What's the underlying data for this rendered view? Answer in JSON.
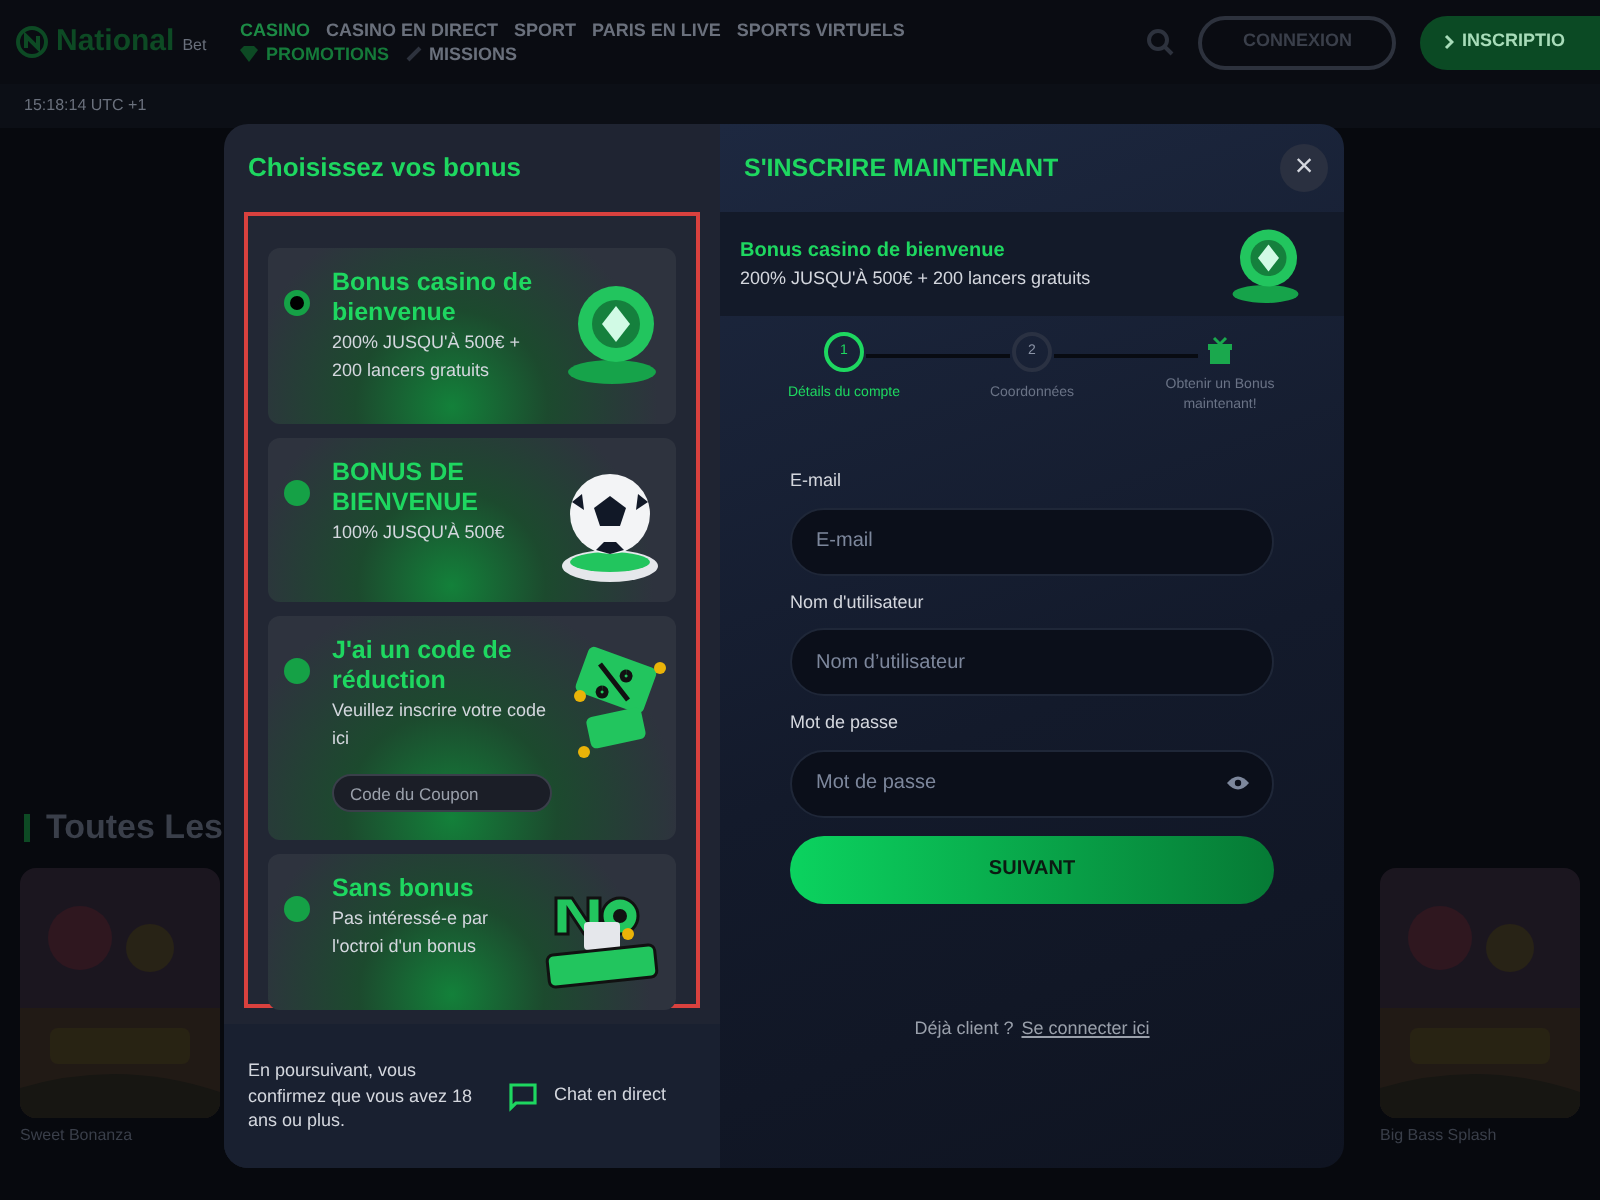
{
  "header": {
    "logo": {
      "name": "National",
      "suffix": "Bet"
    },
    "nav": [
      {
        "label": "CASINO",
        "selected": true,
        "kind": "text"
      },
      {
        "label": "CASINO EN DIRECT",
        "selected": false,
        "kind": "text"
      },
      {
        "label": "SPORT",
        "selected": false,
        "kind": "text"
      },
      {
        "label": "PARIS EN LIVE",
        "selected": false,
        "kind": "text"
      },
      {
        "label": "SPORTS VIRTUELS",
        "selected": false,
        "kind": "text"
      },
      {
        "label": "PROMOTIONS",
        "selected": false,
        "kind": "promo"
      },
      {
        "label": "MISSIONS",
        "selected": false,
        "kind": "missions"
      }
    ],
    "login": "CONNEXION",
    "signup": "INSCRIPTIO",
    "time": "15:18:14 UTC +1"
  },
  "section_title": "Toutes Les",
  "games": [
    {
      "name": "Sweet Bonanza"
    },
    {
      "name": "Big Bass Splash"
    }
  ],
  "modal": {
    "left": {
      "title": "Choisissez vos bonus",
      "options": [
        {
          "title": "Bonus casino de bienvenue",
          "description": "200% JUSQU'À 500€ + 200 lancers gratuits",
          "selected": true,
          "kind": "chip"
        },
        {
          "title": "BONUS DE BIENVENUE",
          "description": "100% JUSQU'À 500€",
          "selected": false,
          "kind": "ball"
        },
        {
          "title": "J'ai un code de réduction",
          "description": "Veuillez inscrire votre code ici",
          "selected": false,
          "kind": "coupon",
          "field": {
            "placeholder": "Code du Coupon"
          }
        },
        {
          "title": "Sans bonus",
          "description": "Pas intéressé-e par l'octroi d'un bonus",
          "selected": false,
          "kind": "nobonus"
        }
      ],
      "footer": "En poursuivant, vous confirmez que vous avez 18 ans ou plus.",
      "chat": "Chat en direct"
    },
    "right": {
      "title": "S'INSCRIRE MAINTENANT",
      "close": "×",
      "bonus": {
        "title": "Bonus casino de bienvenue",
        "description": "200% JUSQU'À 500€ + 200 lancers gratuits"
      },
      "steps": [
        {
          "kind": "number",
          "number": "1",
          "label": "Détails du compte",
          "selected": true
        },
        {
          "kind": "number",
          "number": "2",
          "label": "Coordonnées",
          "selected": false
        },
        {
          "kind": "gift",
          "label": "Obtenir un Bonus maintenant!",
          "selected": false
        }
      ],
      "fields": [
        {
          "label": "E-mail",
          "placeholder": "E-mail",
          "kind": "text"
        },
        {
          "label": "Nom d'utilisateur",
          "placeholder": "Nom d’utilisateur",
          "kind": "text"
        },
        {
          "label": "Mot de passe",
          "placeholder": "Mot de passe",
          "kind": "password"
        }
      ],
      "submit": "SUIVANT",
      "already": "Déjà client ?",
      "login_link": "Se connecter ici"
    }
  }
}
